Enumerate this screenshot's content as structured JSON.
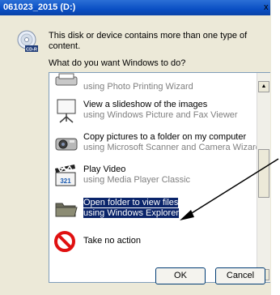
{
  "window": {
    "title": "061023_2015 (D:)",
    "close_glyph": "x"
  },
  "message": "This disk or device contains more than one type of content.",
  "question": "What do you want Windows to do?",
  "icons": {
    "disc": "cd-icon",
    "print": "print-wizard-icon",
    "slideshow": "slideshow-icon",
    "camera": "camera-icon",
    "video": "video-clapper-icon",
    "folder": "folder-icon",
    "noaction": "no-action-icon"
  },
  "disc_label": "CD-R",
  "video_badge": "321",
  "options": [
    {
      "line1": "",
      "line2": "using Photo Printing Wizard"
    },
    {
      "line1": "View a slideshow of the images",
      "line2": "using Windows Picture and Fax Viewer"
    },
    {
      "line1": "Copy pictures to a folder on my computer",
      "line2": "using Microsoft Scanner and Camera Wizard"
    },
    {
      "line1": "Play Video",
      "line2": "using Media Player Classic"
    },
    {
      "line1": "Open folder to view files",
      "line2": "using Windows Explorer"
    },
    {
      "line1": "Take no action",
      "line2": ""
    }
  ],
  "buttons": {
    "ok": "OK",
    "cancel": "Cancel"
  },
  "colors": {
    "titlebar": "#0a4fc4",
    "selection": "#0a246a",
    "dialog": "#ece9d8",
    "arrow": "#000000"
  }
}
